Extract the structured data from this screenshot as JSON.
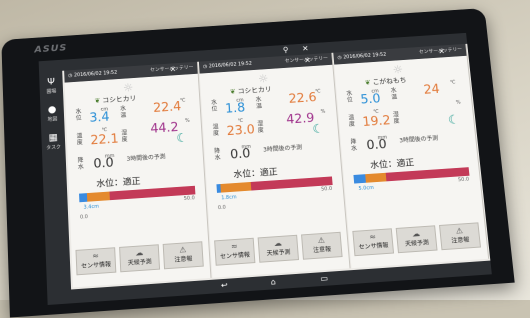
{
  "device": {
    "brand": "ASUS"
  },
  "sidebar": {
    "items": [
      {
        "label": "圃場",
        "icon": "field-icon"
      },
      {
        "label": "地図",
        "icon": "map-pin-icon"
      },
      {
        "label": "タスク",
        "icon": "calendar-icon"
      }
    ]
  },
  "panels": [
    {
      "timestamp": "2016/06/02 19:52",
      "battery": "センサーバッテリー",
      "crop": "コシヒカリ",
      "water_level": "3.4",
      "water_level_unit": "cm",
      "water_level_label": "水位",
      "water_temp": "22.4",
      "water_temp_unit": "℃",
      "water_temp_label": "水温",
      "temperature": "22.1",
      "temperature_unit": "℃",
      "temperature_label": "温度",
      "humidity": "44.2",
      "humidity_unit": "%",
      "humidity_label": "湿度",
      "rainfall": "0.0",
      "rainfall_unit": "mm",
      "rainfall_label": "降水",
      "forecast": "3時間後の予測",
      "status": "水位：適正",
      "bar_label": "3.4cm",
      "scale_min": "0.0",
      "scale_max": "50.0",
      "buttons": [
        "センサ情報",
        "天候予測",
        "注意報"
      ]
    },
    {
      "timestamp": "2016/06/02 19:52",
      "battery": "センサーバッテリー",
      "crop": "コシヒカリ",
      "water_level": "1.8",
      "water_level_unit": "cm",
      "water_level_label": "水位",
      "water_temp": "22.6",
      "water_temp_unit": "℃",
      "water_temp_label": "水温",
      "temperature": "23.0",
      "temperature_unit": "℃",
      "temperature_label": "温度",
      "humidity": "42.9",
      "humidity_unit": "%",
      "humidity_label": "湿度",
      "rainfall": "0.0",
      "rainfall_unit": "mm",
      "rainfall_label": "降水",
      "forecast": "3時間後の予測",
      "status": "水位：適正",
      "bar_label": "1.8cm",
      "scale_min": "0.0",
      "scale_max": "50.0",
      "buttons": [
        "センサ情報",
        "天候予測",
        "注意報"
      ]
    },
    {
      "timestamp": "2016/06/02 19:52",
      "battery": "センサーバッテリー",
      "crop": "こがねもち",
      "water_level": "5.0",
      "water_level_unit": "cm",
      "water_level_label": "水位",
      "water_temp": "24",
      "water_temp_unit": "℃",
      "water_temp_label": "水温",
      "temperature": "19.2",
      "temperature_unit": "℃",
      "temperature_label": "温度",
      "humidity": "",
      "humidity_unit": "%",
      "humidity_label": "湿度",
      "rainfall": "0.0",
      "rainfall_unit": "mm",
      "rainfall_label": "降水",
      "forecast": "3時間後の予測",
      "status": "水位：適正",
      "bar_label": "5.0cm",
      "scale_min": "",
      "scale_max": "50.0",
      "buttons": [
        "センサ情報",
        "天候予測",
        "注意報"
      ]
    }
  ],
  "bar_fill": [
    {
      "water": 0.068,
      "warm": 0.26
    },
    {
      "water": 0.036,
      "warm": 0.3
    },
    {
      "water": 0.1,
      "warm": 0.28
    }
  ],
  "colors": {
    "water": "#2a8fd6",
    "temp": "#e27a3a",
    "humidity": "#a0338c",
    "bar_bg": "#c33a58"
  }
}
